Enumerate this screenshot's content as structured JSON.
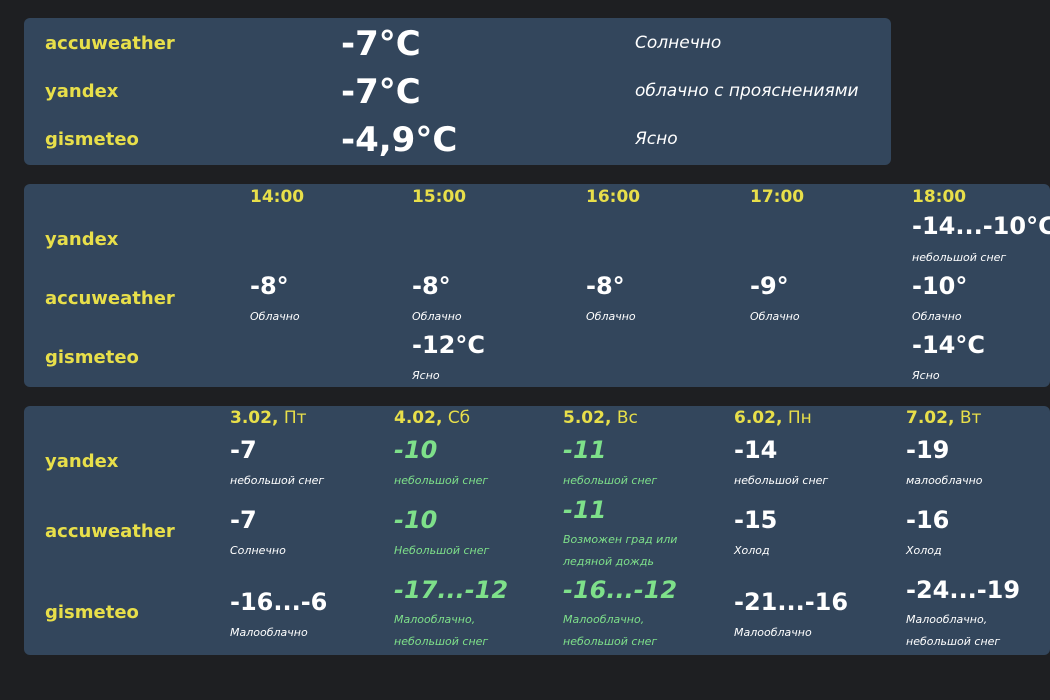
{
  "current": {
    "rows": [
      {
        "source": "accuweather",
        "temp": "-7°C",
        "desc": "Солнечно"
      },
      {
        "source": "yandex",
        "temp": "-7°C",
        "desc": "облачно с прояснениями"
      },
      {
        "source": "gismeteo",
        "temp": "-4,9°C",
        "desc": "Ясно"
      }
    ]
  },
  "hourly": {
    "times": [
      "14:00",
      "15:00",
      "16:00",
      "17:00",
      "18:00"
    ],
    "sources": [
      "yandex",
      "accuweather",
      "gismeteo"
    ],
    "yandex": [
      null,
      null,
      null,
      null,
      {
        "temp": "-14...-10°C",
        "cond": "небольшой снег"
      }
    ],
    "accuweather": [
      {
        "temp": "-8°",
        "cond": "Облачно"
      },
      {
        "temp": "-8°",
        "cond": "Облачно"
      },
      {
        "temp": "-8°",
        "cond": "Облачно"
      },
      {
        "temp": "-9°",
        "cond": "Облачно"
      },
      {
        "temp": "-10°",
        "cond": "Облачно"
      }
    ],
    "gismeteo": [
      null,
      {
        "temp": "-12°C",
        "cond": "Ясно"
      },
      null,
      null,
      {
        "temp": "-14°C",
        "cond": "Ясно"
      }
    ]
  },
  "daily": {
    "days": [
      {
        "date": "3.02,",
        "dow": "Пт"
      },
      {
        "date": "4.02,",
        "dow": "Сб"
      },
      {
        "date": "5.02,",
        "dow": "Вс"
      },
      {
        "date": "6.02,",
        "dow": "Пн"
      },
      {
        "date": "7.02,",
        "dow": "Вт"
      }
    ],
    "sources": [
      "yandex",
      "accuweather",
      "gismeteo"
    ],
    "yandex": [
      {
        "temp": "-7",
        "cond": "небольшой снег",
        "weekend": false
      },
      {
        "temp": "-10",
        "cond": "небольшой снег",
        "weekend": true
      },
      {
        "temp": "-11",
        "cond": "небольшой снег",
        "weekend": true
      },
      {
        "temp": "-14",
        "cond": "небольшой снег",
        "weekend": false
      },
      {
        "temp": "-19",
        "cond": "малооблачно",
        "weekend": false
      }
    ],
    "accuweather": [
      {
        "temp": "-7",
        "cond": "Солнечно",
        "weekend": false
      },
      {
        "temp": "-10",
        "cond": "Небольшой снег",
        "weekend": true
      },
      {
        "temp": "-11",
        "cond": "Возможен град или ледяной дождь",
        "weekend": true
      },
      {
        "temp": "-15",
        "cond": "Холод",
        "weekend": false
      },
      {
        "temp": "-16",
        "cond": "Холод",
        "weekend": false
      }
    ],
    "gismeteo": [
      {
        "temp": "-16...-6",
        "cond": "Малооблачно",
        "weekend": false
      },
      {
        "temp": "-17...-12",
        "cond": "Малооблачно, небольшой снег",
        "weekend": true
      },
      {
        "temp": "-16...-12",
        "cond": "Малооблачно, небольшой снег",
        "weekend": true
      },
      {
        "temp": "-21...-16",
        "cond": "Малооблачно",
        "weekend": false
      },
      {
        "temp": "-24...-19",
        "cond": "Малооблачно, небольшой снег",
        "weekend": false
      }
    ]
  },
  "colors": {
    "background": "#1e1f22",
    "panel": "#33465c",
    "source_label": "#e8df4a",
    "weekend": "#7ee08a",
    "text": "#ffffff"
  }
}
